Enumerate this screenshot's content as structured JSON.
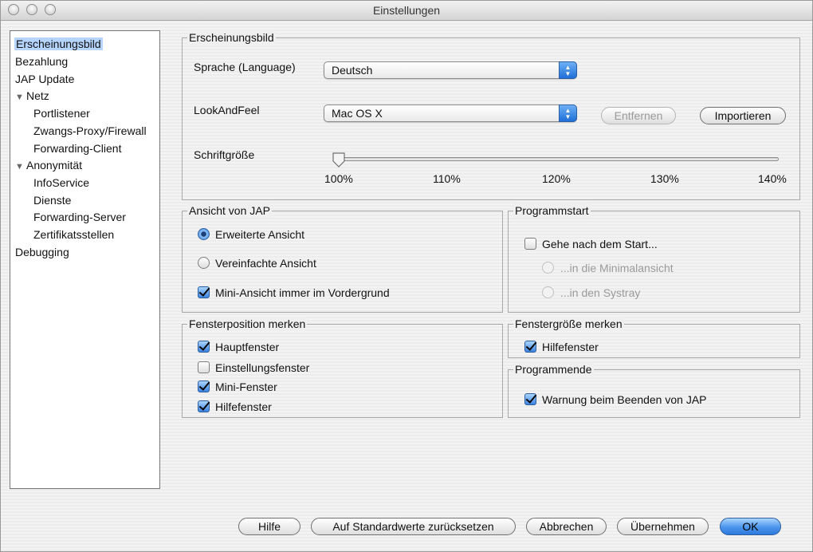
{
  "window": {
    "title": "Einstellungen"
  },
  "tree": {
    "items": [
      {
        "label": "Erscheinungsbild",
        "indent": 0,
        "selected": true
      },
      {
        "label": "Bezahlung",
        "indent": 0
      },
      {
        "label": "JAP Update",
        "indent": 0
      },
      {
        "label": "Netz",
        "indent": 0,
        "expanded": true
      },
      {
        "label": "Portlistener",
        "indent": 1
      },
      {
        "label": "Zwangs-Proxy/Firewall",
        "indent": 1
      },
      {
        "label": "Forwarding-Client",
        "indent": 1
      },
      {
        "label": "Anonymität",
        "indent": 0,
        "expanded": true
      },
      {
        "label": "InfoService",
        "indent": 1
      },
      {
        "label": "Dienste",
        "indent": 1
      },
      {
        "label": "Forwarding-Server",
        "indent": 1
      },
      {
        "label": "Zertifikatsstellen",
        "indent": 1
      },
      {
        "label": "Debugging",
        "indent": 0
      }
    ]
  },
  "appearance": {
    "legend": "Erscheinungsbild",
    "language_label": "Sprache (Language)",
    "language_value": "Deutsch",
    "laf_label": "LookAndFeel",
    "laf_value": "Mac OS X",
    "remove_button": "Entfernen",
    "import_button": "Importieren",
    "font_size_label": "Schriftgröße",
    "font_size_ticks": [
      "100%",
      "110%",
      "120%",
      "130%",
      "140%"
    ],
    "font_size_value": "100%"
  },
  "view": {
    "legend": "Ansicht von JAP",
    "extended": "Erweiterte Ansicht",
    "simplified": "Vereinfachte Ansicht",
    "mini_on_top": "Mini-Ansicht immer im Vordergrund"
  },
  "startup": {
    "legend": "Programmstart",
    "after_start": "Gehe nach dem Start...",
    "minimal": "...in die Minimalansicht",
    "systray": "...in den Systray"
  },
  "window_pos": {
    "legend": "Fensterposition merken",
    "main": "Hauptfenster",
    "settings": "Einstellungsfenster",
    "mini": "Mini-Fenster",
    "help": "Hilfefenster"
  },
  "window_size": {
    "legend": "Fenstergröße merken",
    "help": "Hilfefenster"
  },
  "exit": {
    "legend": "Programmende",
    "warn": "Warnung beim Beenden von JAP"
  },
  "footer": {
    "help": "Hilfe",
    "reset": "Auf Standardwerte zurücksetzen",
    "cancel": "Abbrechen",
    "apply": "Übernehmen",
    "ok": "OK"
  }
}
